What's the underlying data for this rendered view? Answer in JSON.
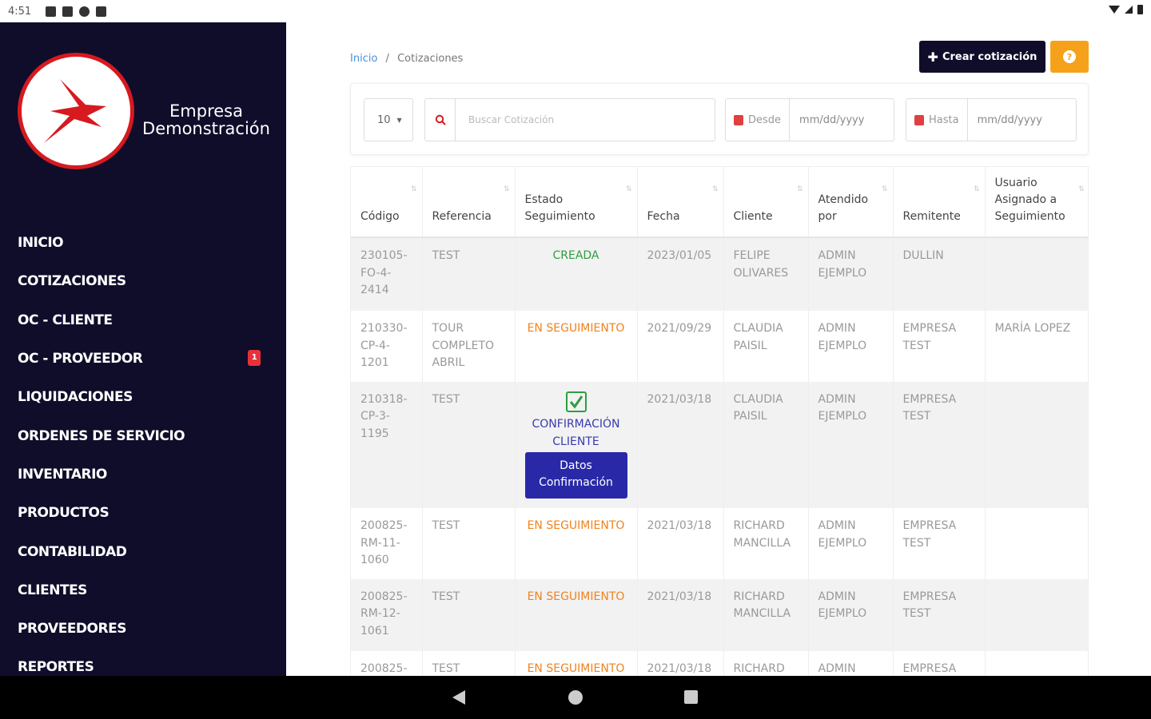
{
  "status_bar": {
    "time": "4:51"
  },
  "brand": {
    "line1": "Empresa",
    "line2": "Demonstración"
  },
  "sidebar": {
    "items": [
      {
        "label": "INICIO"
      },
      {
        "label": "COTIZACIONES"
      },
      {
        "label": "OC - CLIENTE"
      },
      {
        "label": "OC - PROVEEDOR",
        "badge": "1"
      },
      {
        "label": "LIQUIDACIONES"
      },
      {
        "label": "ORDENES DE SERVICIO"
      },
      {
        "label": "INVENTARIO"
      },
      {
        "label": "PRODUCTOS"
      },
      {
        "label": "CONTABILIDAD"
      },
      {
        "label": "CLIENTES"
      },
      {
        "label": "PROVEEDORES"
      },
      {
        "label": "REPORTES"
      }
    ]
  },
  "breadcrumb": {
    "home": "Inicio",
    "separator": "/",
    "current": "Cotizaciones"
  },
  "toolbar": {
    "create_label": "Crear cotización",
    "help_label": "?"
  },
  "filters": {
    "page_size": "10",
    "search_placeholder": "Buscar Cotización",
    "from_label": "Desde",
    "from_value": "mm/dd/yyyy",
    "to_label": "Hasta",
    "to_value": "mm/dd/yyyy"
  },
  "colors": {
    "sidebar_bg": "#0f0d2a",
    "help_button": "#f5a21a",
    "confirm_button": "#2929a8",
    "status_created": "#2e9e3e",
    "status_following": "#f0821e",
    "status_confirmed": "#3a3ab0"
  },
  "table": {
    "columns": [
      {
        "label": "Código"
      },
      {
        "label": "Referencia"
      },
      {
        "label": "Estado Seguimiento"
      },
      {
        "label": "Fecha"
      },
      {
        "label": "Cliente"
      },
      {
        "label": "Atendido por"
      },
      {
        "label": "Remitente"
      },
      {
        "label": "Usuario Asignado a Seguimiento"
      }
    ],
    "rows": [
      {
        "codigo": "230105-FO-4-2414",
        "referencia": "TEST",
        "estado": "CREADA",
        "fecha": "2023/01/05",
        "cliente": "FELIPE OLIVARES",
        "atendido": "ADMIN EJEMPLO",
        "remitente": "DULLIN",
        "usuario": ""
      },
      {
        "codigo": "210330-CP-4-1201",
        "referencia": "TOUR COMPLETO ABRIL",
        "estado": "EN SEGUIMIENTO",
        "fecha": "2021/09/29",
        "cliente": "CLAUDIA PAISIL",
        "atendido": "ADMIN EJEMPLO",
        "remitente": "EMPRESA TEST",
        "usuario": "MARÍA LOPEZ"
      },
      {
        "codigo": "210318-CP-3-1195",
        "referencia": "TEST",
        "estado": "CONFIRMACIÓN CLIENTE",
        "action": "Datos Confirmación",
        "fecha": "2021/03/18",
        "cliente": "CLAUDIA PAISIL",
        "atendido": "ADMIN EJEMPLO",
        "remitente": "EMPRESA TEST",
        "usuario": ""
      },
      {
        "codigo": "200825-RM-11-1060",
        "referencia": "TEST",
        "estado": "EN SEGUIMIENTO",
        "fecha": "2021/03/18",
        "cliente": "RICHARD MANCILLA",
        "atendido": "ADMIN EJEMPLO",
        "remitente": "EMPRESA TEST",
        "usuario": ""
      },
      {
        "codigo": "200825-RM-12-1061",
        "referencia": "TEST",
        "estado": "EN SEGUIMIENTO",
        "fecha": "2021/03/18",
        "cliente": "RICHARD MANCILLA",
        "atendido": "ADMIN EJEMPLO",
        "remitente": "EMPRESA TEST",
        "usuario": ""
      },
      {
        "codigo": "200825-",
        "referencia": "TEST",
        "estado": "EN SEGUIMIENTO",
        "fecha": "2021/03/18",
        "cliente": "RICHARD",
        "atendido": "ADMIN",
        "remitente": "EMPRESA",
        "usuario": ""
      }
    ]
  }
}
